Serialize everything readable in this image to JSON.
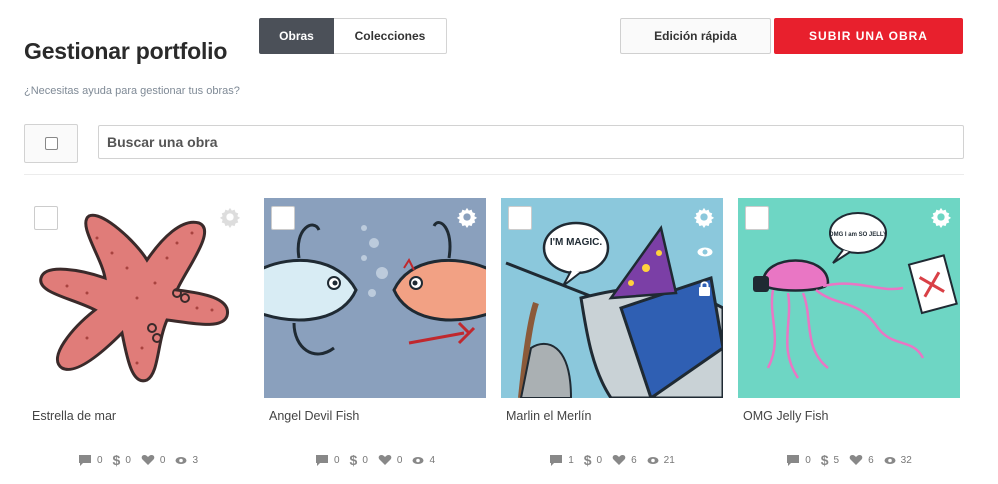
{
  "header": {
    "title": "Gestionar portfolio",
    "help_link": "¿Necesitas ayuda para gestionar tus obras?",
    "tabs": [
      {
        "label": "Obras",
        "active": true
      },
      {
        "label": "Colecciones",
        "active": false
      }
    ],
    "quick_edit_label": "Edición rápida",
    "upload_label": "SUBIR UNA OBRA"
  },
  "toolbar": {
    "search_placeholder": "Buscar una obra"
  },
  "colors": {
    "accent_red": "#e8202d",
    "tab_active_bg": "#4b5058"
  },
  "works": [
    {
      "title": "Estrella de mar",
      "image": "starfish",
      "comments": "0",
      "sales": "0",
      "likes": "0",
      "views": "3"
    },
    {
      "title": "Angel Devil Fish",
      "image": "angel-devil-fish",
      "comments": "0",
      "sales": "0",
      "likes": "0",
      "views": "4"
    },
    {
      "title": "Marlin el Merlín",
      "image": "wizard-marlin",
      "speech": "I'M MAGIC.",
      "comments": "1",
      "sales": "0",
      "likes": "6",
      "views": "21"
    },
    {
      "title": "OMG Jelly Fish",
      "image": "jellyfish",
      "speech": "OMG I am SO JELLY",
      "comments": "0",
      "sales": "5",
      "likes": "6",
      "views": "32"
    }
  ]
}
